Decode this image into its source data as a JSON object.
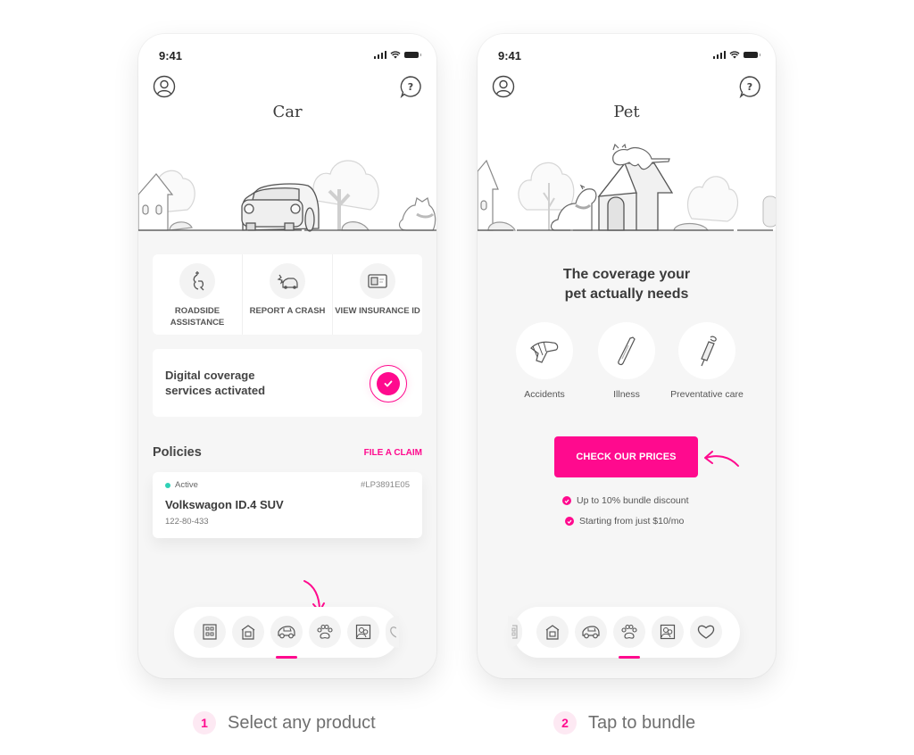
{
  "brand": {
    "accent": "#ff0a8e",
    "active_dot": "#2fd1b6"
  },
  "screens": {
    "car": {
      "status_time": "9:41",
      "title": "Car",
      "actions": [
        {
          "icon": "tow-hook-icon",
          "label": "Roadside Assistance"
        },
        {
          "icon": "car-crash-icon",
          "label": "Report a Crash"
        },
        {
          "icon": "id-card-icon",
          "label": "View Insurance ID"
        }
      ],
      "coverage": {
        "text": "Digital coverage services activated",
        "status_icon": "check-icon"
      },
      "policies": {
        "title": "Policies",
        "file_claim": "FILE A CLAIM",
        "items": [
          {
            "status": "Active",
            "id": "#LP3891E05",
            "name": "Volkswagon ID.4 SUV",
            "number": "122-80-433"
          }
        ]
      },
      "product_nav": {
        "items": [
          "apartment-icon",
          "home-icon",
          "car-icon",
          "paw-icon",
          "life-icon",
          "heart-icon"
        ],
        "selected": "car-icon"
      }
    },
    "pet": {
      "status_time": "9:41",
      "title": "Pet",
      "heading": "The coverage your pet actually needs",
      "benefits": [
        {
          "icon": "bandaged-paw-icon",
          "label": "Accidents"
        },
        {
          "icon": "thermometer-icon",
          "label": "Illness"
        },
        {
          "icon": "syringe-icon",
          "label": "Preventative care"
        }
      ],
      "cta": "CHECK OUR PRICES",
      "perks": [
        "Up to 10% bundle discount",
        "Starting from just $10/mo"
      ],
      "product_nav": {
        "items": [
          "apartment-icon",
          "home-icon",
          "car-icon",
          "paw-icon",
          "life-icon",
          "heart-icon"
        ],
        "selected": "paw-icon"
      }
    }
  },
  "captions": [
    {
      "number": "1",
      "text": "Select any product"
    },
    {
      "number": "2",
      "text": "Tap to bundle"
    }
  ]
}
